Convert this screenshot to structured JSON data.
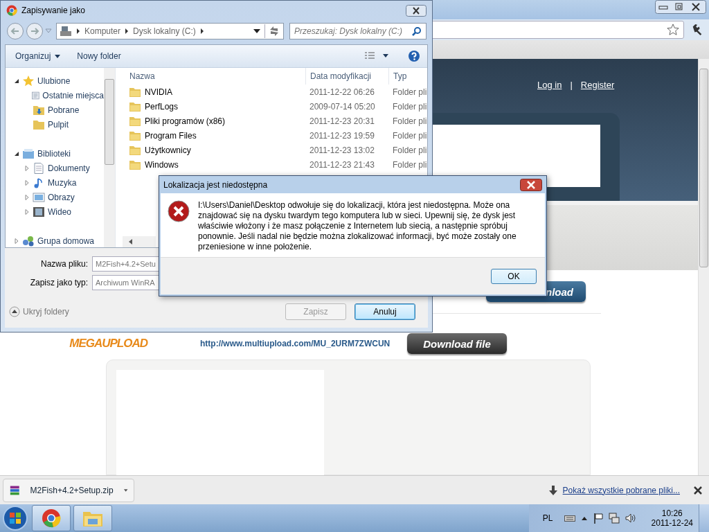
{
  "browser": {
    "header_links": [
      {
        "label": "Log in"
      },
      {
        "label": "Register"
      }
    ],
    "separator": "|",
    "logo": "MEGAUPLOAD",
    "link": "http://www.multiupload.com/MU_2URM7ZWCUN",
    "buttons": [
      {
        "label": "nload",
        "kind": "blue"
      },
      {
        "label": "Download file",
        "kind": "dark"
      }
    ]
  },
  "save_dialog": {
    "title": "Zapisywanie jako",
    "breadcrumb": [
      "Komputer",
      "Dysk lokalny (C:)"
    ],
    "search_placeholder": "Przeszukaj: Dysk lokalny (C:)",
    "toolbar": [
      "Organizuj",
      "Nowy folder"
    ],
    "sidebar": [
      {
        "label": "Ulubione",
        "kind": "star",
        "expanded": true,
        "children": [
          {
            "label": "Ostatnie miejsca",
            "kind": "recent"
          },
          {
            "label": "Pobrane",
            "kind": "download"
          },
          {
            "label": "Pulpit",
            "kind": "folder"
          }
        ]
      },
      {
        "label": "Biblioteki",
        "kind": "library",
        "expanded": true,
        "children": [
          {
            "label": "Dokumenty",
            "kind": "document",
            "expanded": false
          },
          {
            "label": "Muzyka",
            "kind": "music",
            "expanded": false
          },
          {
            "label": "Obrazy",
            "kind": "image",
            "expanded": false
          },
          {
            "label": "Wideo",
            "kind": "video",
            "expanded": false
          }
        ]
      },
      {
        "label": "Grupa domowa",
        "kind": "homegroup",
        "expanded": false
      }
    ],
    "columns": [
      "Nazwa",
      "Data modyfikacji",
      "Typ"
    ],
    "rows": [
      {
        "name": "NVIDIA",
        "date": "2011-12-22 06:26",
        "type": "Folder pli"
      },
      {
        "name": "PerfLogs",
        "date": "2009-07-14 05:20",
        "type": "Folder pli"
      },
      {
        "name": "Pliki programów (x86)",
        "date": "2011-12-23 20:31",
        "type": "Folder pli"
      },
      {
        "name": "Program Files",
        "date": "2011-12-23 19:59",
        "type": "Folder pli"
      },
      {
        "name": "Użytkownicy",
        "date": "2011-12-23 13:02",
        "type": "Folder pli"
      },
      {
        "name": "Windows",
        "date": "2011-12-23 21:43",
        "type": "Folder pli"
      }
    ],
    "fields": [
      {
        "label": "Nazwa pliku:",
        "value": "M2Fish+4.2+Setu"
      },
      {
        "label": "Zapisz jako typ:",
        "value": "Archiwum WinRA"
      }
    ],
    "hide_folders": "Ukryj foldery",
    "buttons": [
      {
        "label": "Zapisz",
        "disabled": true
      },
      {
        "label": "Anuluj",
        "disabled": false
      }
    ]
  },
  "error_dialog": {
    "title": "Lokalizacja jest niedostępna",
    "message": "I:\\Users\\Daniel\\Desktop odwołuje się do lokalizacji, która jest niedostępna. Może ona znajdować się na dysku twardym tego komputera lub w sieci. Upewnij się, że dysk jest właściwie włożony i że masz połączenie z Internetem lub siecią, a następnie spróbuj ponownie. Jeśli nadal nie będzie można zlokalizować informacji, być może zostały one przeniesione w inne położenie.",
    "button": "OK"
  },
  "download_bar": {
    "file": "M2Fish+4.2+Setup.zip",
    "show_all": "Pokaż wszystkie pobrane pliki..."
  },
  "taskbar": {
    "language": "PL",
    "time": "10:26",
    "date": "2011-12-24"
  }
}
